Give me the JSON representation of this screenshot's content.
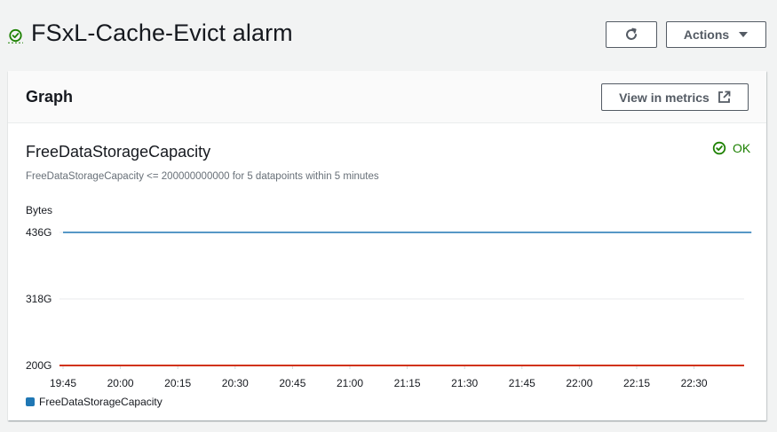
{
  "header": {
    "title": "FSxL-Cache-Evict alarm",
    "status_icon": "check-circle-icon",
    "actions_label": "Actions"
  },
  "graph_panel": {
    "title": "Graph",
    "view_in_metrics_label": "View in metrics",
    "metric_name": "FreeDataStorageCapacity",
    "status_label": "OK",
    "condition": "FreeDataStorageCapacity <= 200000000000 for 5 datapoints within 5 minutes"
  },
  "colors": {
    "ok_green": "#1d8102",
    "series_blue": "#1f77b4",
    "threshold_red": "#d13212"
  },
  "chart_data": {
    "type": "line",
    "ylabel": "Bytes",
    "y_ticks": [
      "436G",
      "318G",
      "200G"
    ],
    "y_tick_values": [
      436,
      318,
      200
    ],
    "ylim": [
      200,
      436
    ],
    "x_ticks": [
      "19:45",
      "20:00",
      "20:15",
      "20:30",
      "20:45",
      "21:00",
      "21:15",
      "21:30",
      "21:45",
      "22:00",
      "22:15",
      "22:30"
    ],
    "series": [
      {
        "name": "FreeDataStorageCapacity",
        "x": [
          "19:45",
          "22:45"
        ],
        "values": [
          436,
          436
        ]
      }
    ],
    "threshold": {
      "value": 200
    },
    "grid": true,
    "legend": "bottom-left"
  }
}
